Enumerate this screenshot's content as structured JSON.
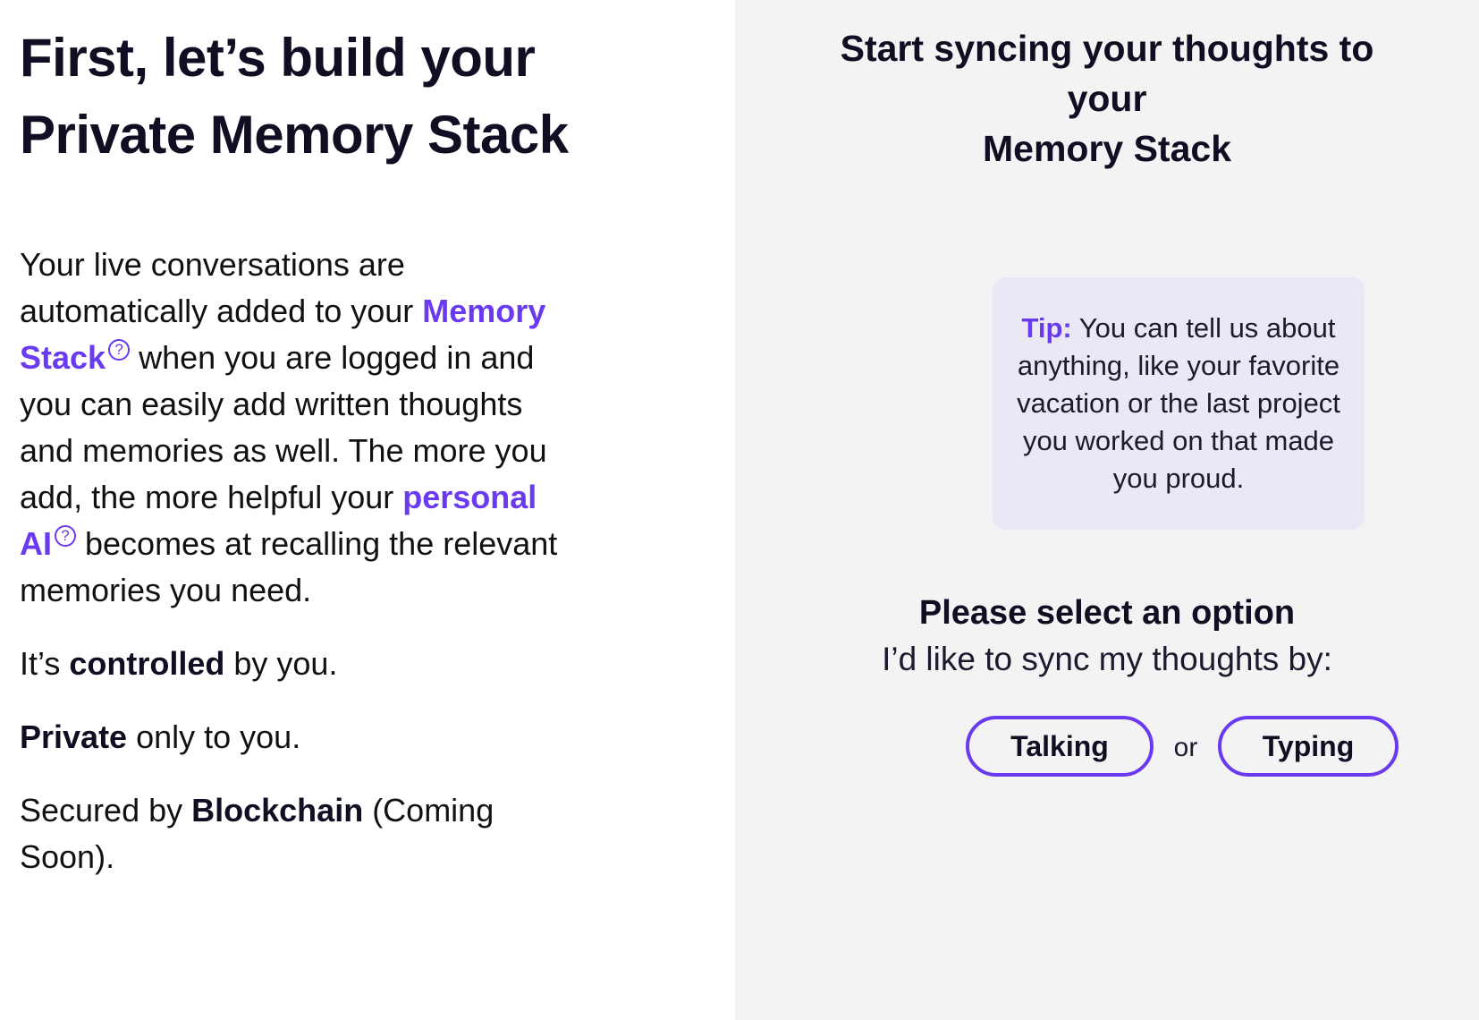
{
  "left": {
    "heading": "First, let’s build your Private Memory Stack",
    "intro": {
      "part1": "Your live conversations are automatically added to your ",
      "memory_stack_link": "Memory Stack",
      "part2": " when you are logged in and you can easily add written thoughts and memories as well. The more you add, the more helpful your ",
      "personal_ai_link": "personal AI",
      "part3": " becomes at recalling the relevant memories you need."
    },
    "controlled": {
      "prefix": "It’s ",
      "bold": "controlled",
      "suffix": " by you."
    },
    "private": {
      "bold": "Private",
      "suffix": " only to you."
    },
    "secured": {
      "prefix": "Secured by ",
      "bold": "Blockchain",
      "suffix": " (Coming Soon)."
    },
    "help_glyph": "?"
  },
  "right": {
    "title_line1": "Start syncing your thoughts to",
    "title_line2": "your",
    "title_line3": "Memory Stack",
    "tip": {
      "label": "Tip:",
      "text": " You can tell us about anything, like your favorite vacation or the last project you worked on that made you proud."
    },
    "select_title": "Please select an option",
    "select_subtitle": "I’d like to sync my thoughts by:",
    "option_talking": "Talking",
    "option_or": "or",
    "option_typing": "Typing"
  },
  "colors": {
    "accent": "#6a3af0",
    "right_panel_bg": "#f3f3f4",
    "tip_bg": "#e9e8f4",
    "text": "#0f0e22"
  }
}
